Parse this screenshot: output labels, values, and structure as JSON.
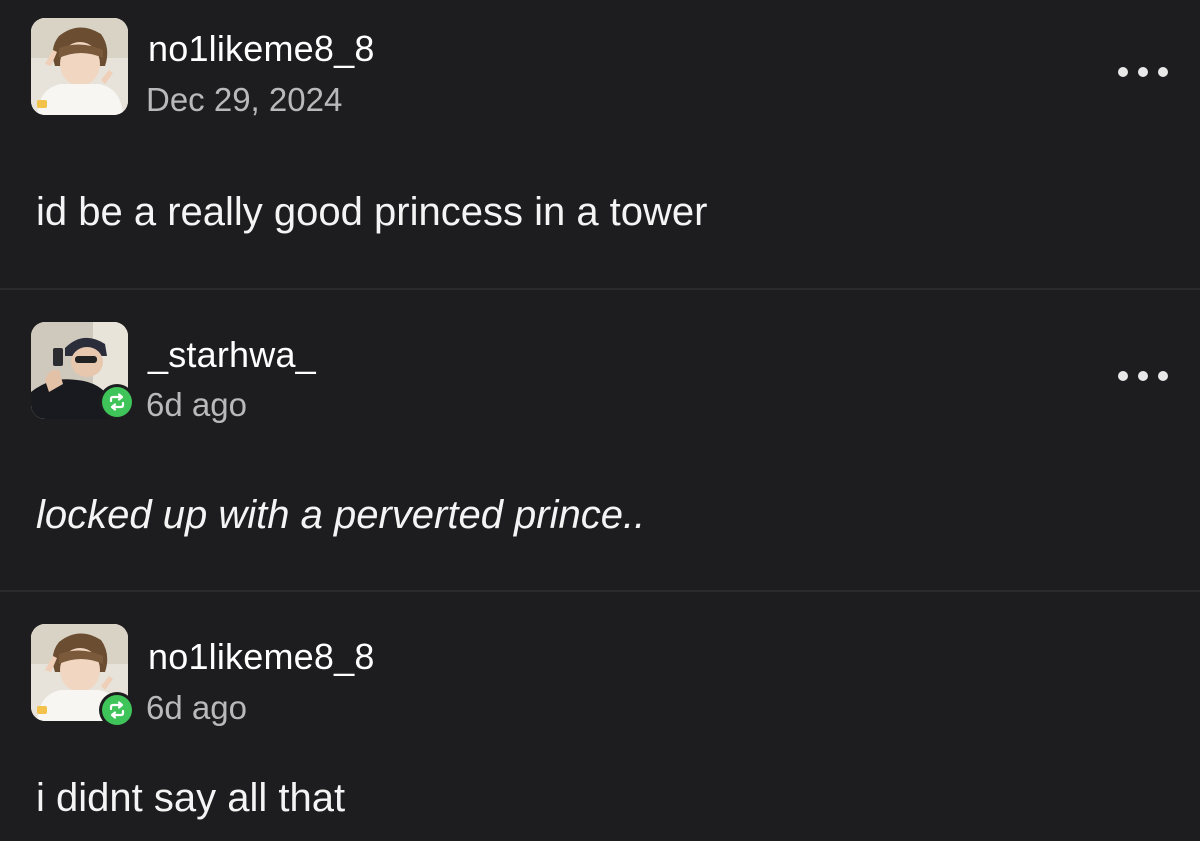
{
  "posts": [
    {
      "username": "no1likeme8_8",
      "timestamp": "Dec 29, 2024",
      "body": "id be a really good princess in a tower",
      "reblogged": false,
      "italic": false
    },
    {
      "username": "_starhwa_",
      "timestamp": "6d ago",
      "body": "locked up with a perverted prince..",
      "reblogged": true,
      "italic": true
    },
    {
      "username": "no1likeme8_8",
      "timestamp": "6d ago",
      "body": "i didnt say all that",
      "reblogged": true,
      "italic": false
    }
  ],
  "icons": {
    "more": "more-options-icon",
    "reblog": "reblog-icon"
  },
  "colors": {
    "background": "#1d1d1f",
    "reblog_badge": "#3fc45a",
    "timestamp": "#b9b9bb"
  }
}
